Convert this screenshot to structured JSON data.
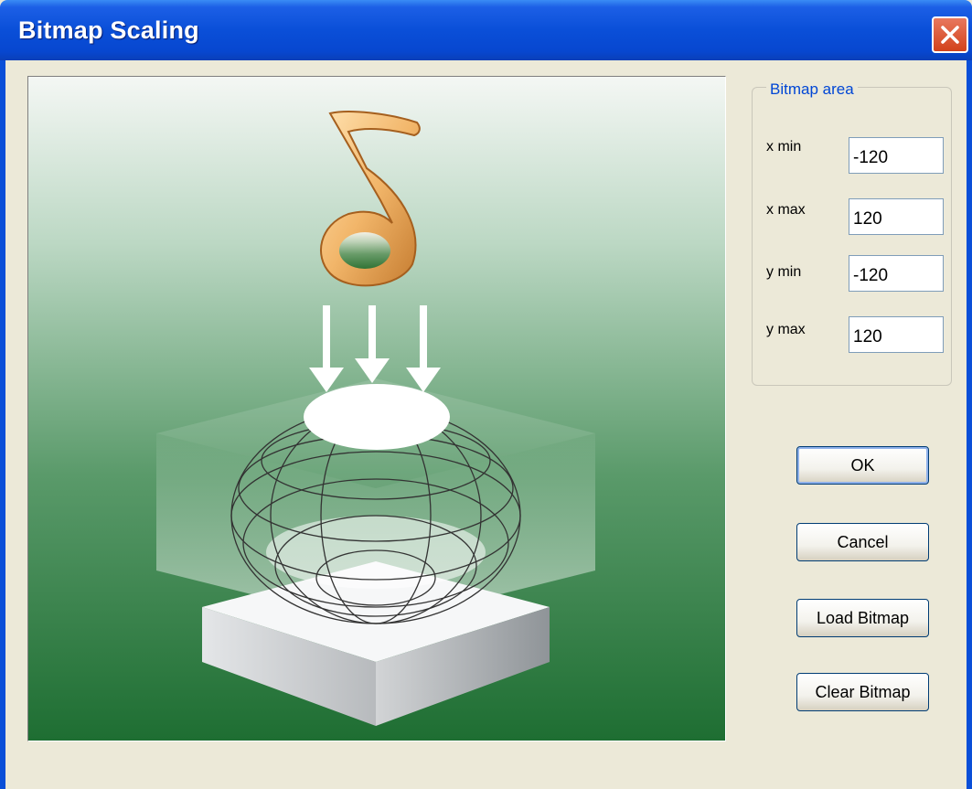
{
  "window": {
    "title": "Bitmap Scaling"
  },
  "title_bar": {
    "close_icon": "close-icon"
  },
  "preview": {
    "image": "sound-diffuser-illustration"
  },
  "bitmap_area": {
    "legend": "Bitmap area",
    "fields": [
      {
        "label": "x min",
        "value": "-120"
      },
      {
        "label": "x max",
        "value": "120"
      },
      {
        "label": "y min",
        "value": "-120"
      },
      {
        "label": "y max",
        "value": "120"
      }
    ]
  },
  "buttons": {
    "ok": "OK",
    "cancel": "Cancel",
    "load": "Load Bitmap",
    "clear": "Clear Bitmap"
  },
  "colors": {
    "title_bar": "#0a4fd8",
    "dialog_bg": "#ece9d8",
    "close_button": "#d2421c",
    "legend_text": "#0046d5",
    "preview_top": "#f4f7f4",
    "preview_bottom": "#1e6e32"
  }
}
